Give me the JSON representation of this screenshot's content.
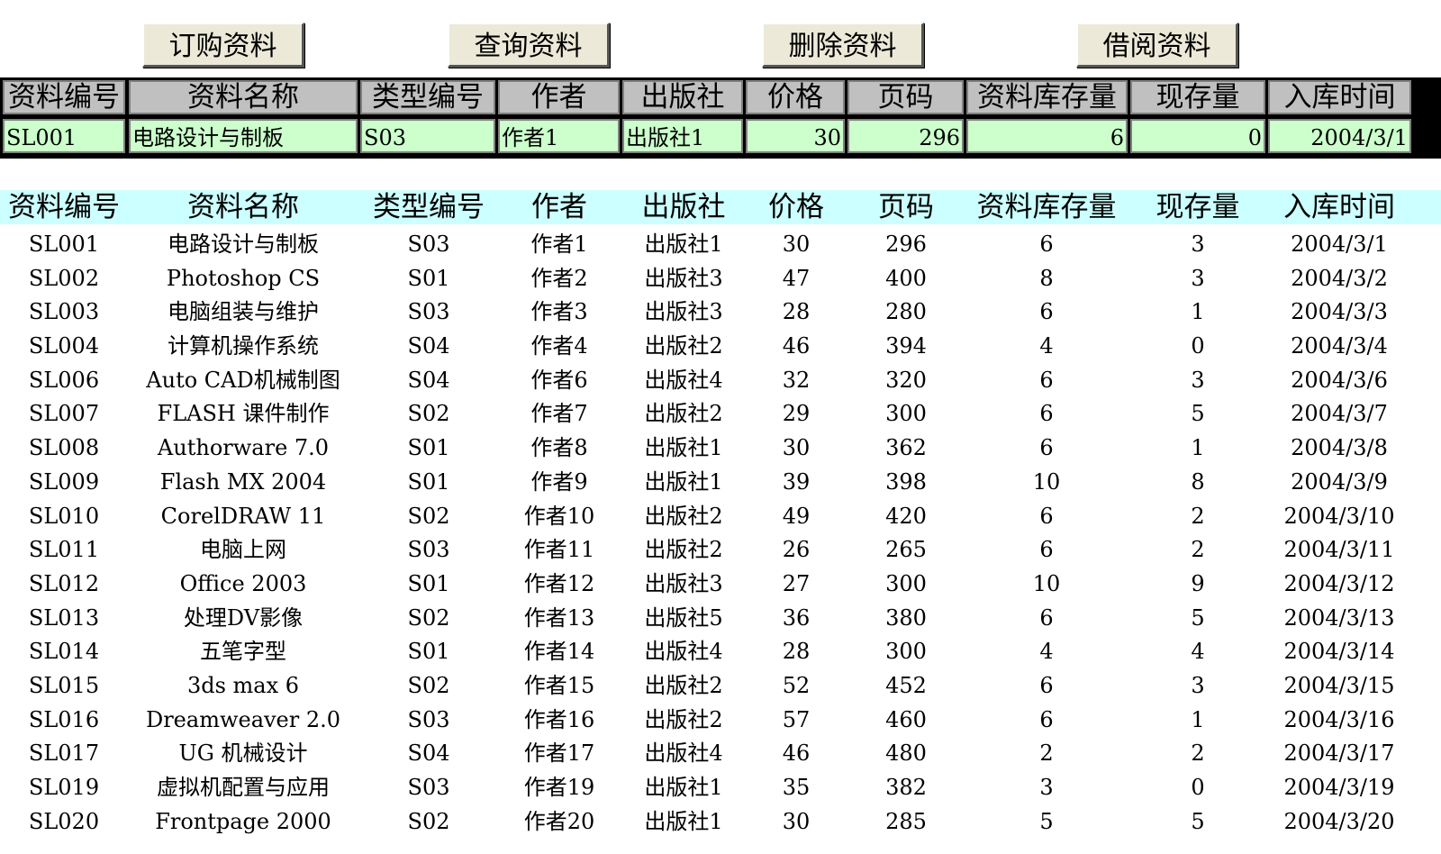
{
  "buttons": {
    "order": "订购资料",
    "query": "查询资料",
    "delete": "删除资料",
    "borrow": "借阅资料"
  },
  "form": {
    "headers": [
      "资料编号",
      "资料名称",
      "类型编号",
      "作者",
      "出版社",
      "价格",
      "页码",
      "资料库存量",
      "现存量",
      "入库时间"
    ],
    "values": [
      "SL001",
      "电路设计与制板",
      "S03",
      "作者1",
      "出版社1",
      "30",
      "296",
      "6",
      "0",
      "2004/3/1"
    ]
  },
  "table": {
    "headers": [
      "资料编号",
      "资料名称",
      "类型编号",
      "作者",
      "出版社",
      "价格",
      "页码",
      "资料库存量",
      "现存量",
      "入库时间"
    ],
    "rows": [
      [
        "SL001",
        "电路设计与制板",
        "S03",
        "作者1",
        "出版社1",
        "30",
        "296",
        "6",
        "3",
        "2004/3/1"
      ],
      [
        "SL002",
        "Photoshop CS",
        "S01",
        "作者2",
        "出版社3",
        "47",
        "400",
        "8",
        "3",
        "2004/3/2"
      ],
      [
        "SL003",
        "电脑组装与维护",
        "S03",
        "作者3",
        "出版社3",
        "28",
        "280",
        "6",
        "1",
        "2004/3/3"
      ],
      [
        "SL004",
        "计算机操作系统",
        "S04",
        "作者4",
        "出版社2",
        "46",
        "394",
        "4",
        "0",
        "2004/3/4"
      ],
      [
        "SL006",
        "Auto CAD机械制图",
        "S04",
        "作者6",
        "出版社4",
        "32",
        "320",
        "6",
        "3",
        "2004/3/6"
      ],
      [
        "SL007",
        "FLASH 课件制作",
        "S02",
        "作者7",
        "出版社2",
        "29",
        "300",
        "6",
        "5",
        "2004/3/7"
      ],
      [
        "SL008",
        "Authorware 7.0",
        "S01",
        "作者8",
        "出版社1",
        "30",
        "362",
        "6",
        "1",
        "2004/3/8"
      ],
      [
        "SL009",
        "Flash MX 2004",
        "S01",
        "作者9",
        "出版社1",
        "39",
        "398",
        "10",
        "8",
        "2004/3/9"
      ],
      [
        "SL010",
        "CorelDRAW 11",
        "S02",
        "作者10",
        "出版社2",
        "49",
        "420",
        "6",
        "2",
        "2004/3/10"
      ],
      [
        "SL011",
        "电脑上网",
        "S03",
        "作者11",
        "出版社2",
        "26",
        "265",
        "6",
        "2",
        "2004/3/11"
      ],
      [
        "SL012",
        "Office 2003",
        "S01",
        "作者12",
        "出版社3",
        "27",
        "300",
        "10",
        "9",
        "2004/3/12"
      ],
      [
        "SL013",
        "处理DV影像",
        "S02",
        "作者13",
        "出版社5",
        "36",
        "380",
        "6",
        "5",
        "2004/3/13"
      ],
      [
        "SL014",
        "五笔字型",
        "S01",
        "作者14",
        "出版社4",
        "28",
        "300",
        "4",
        "4",
        "2004/3/14"
      ],
      [
        "SL015",
        "3ds max 6",
        "S02",
        "作者15",
        "出版社2",
        "52",
        "452",
        "6",
        "3",
        "2004/3/15"
      ],
      [
        "SL016",
        "Dreamweaver 2.0",
        "S03",
        "作者16",
        "出版社2",
        "57",
        "460",
        "6",
        "1",
        "2004/3/16"
      ],
      [
        "SL017",
        "UG 机械设计",
        "S04",
        "作者17",
        "出版社4",
        "46",
        "480",
        "2",
        "2",
        "2004/3/17"
      ],
      [
        "SL019",
        "虚拟机配置与应用",
        "S03",
        "作者19",
        "出版社1",
        "35",
        "382",
        "3",
        "0",
        "2004/3/19"
      ],
      [
        "SL020",
        "Frontpage 2000",
        "S02",
        "作者20",
        "出版社1",
        "30",
        "285",
        "5",
        "5",
        "2004/3/20"
      ]
    ]
  },
  "colors": {
    "button_face": "#ece9d8",
    "form_header": "#c0c0c0",
    "form_input": "#ccffcc",
    "list_header": "#ccffff"
  }
}
